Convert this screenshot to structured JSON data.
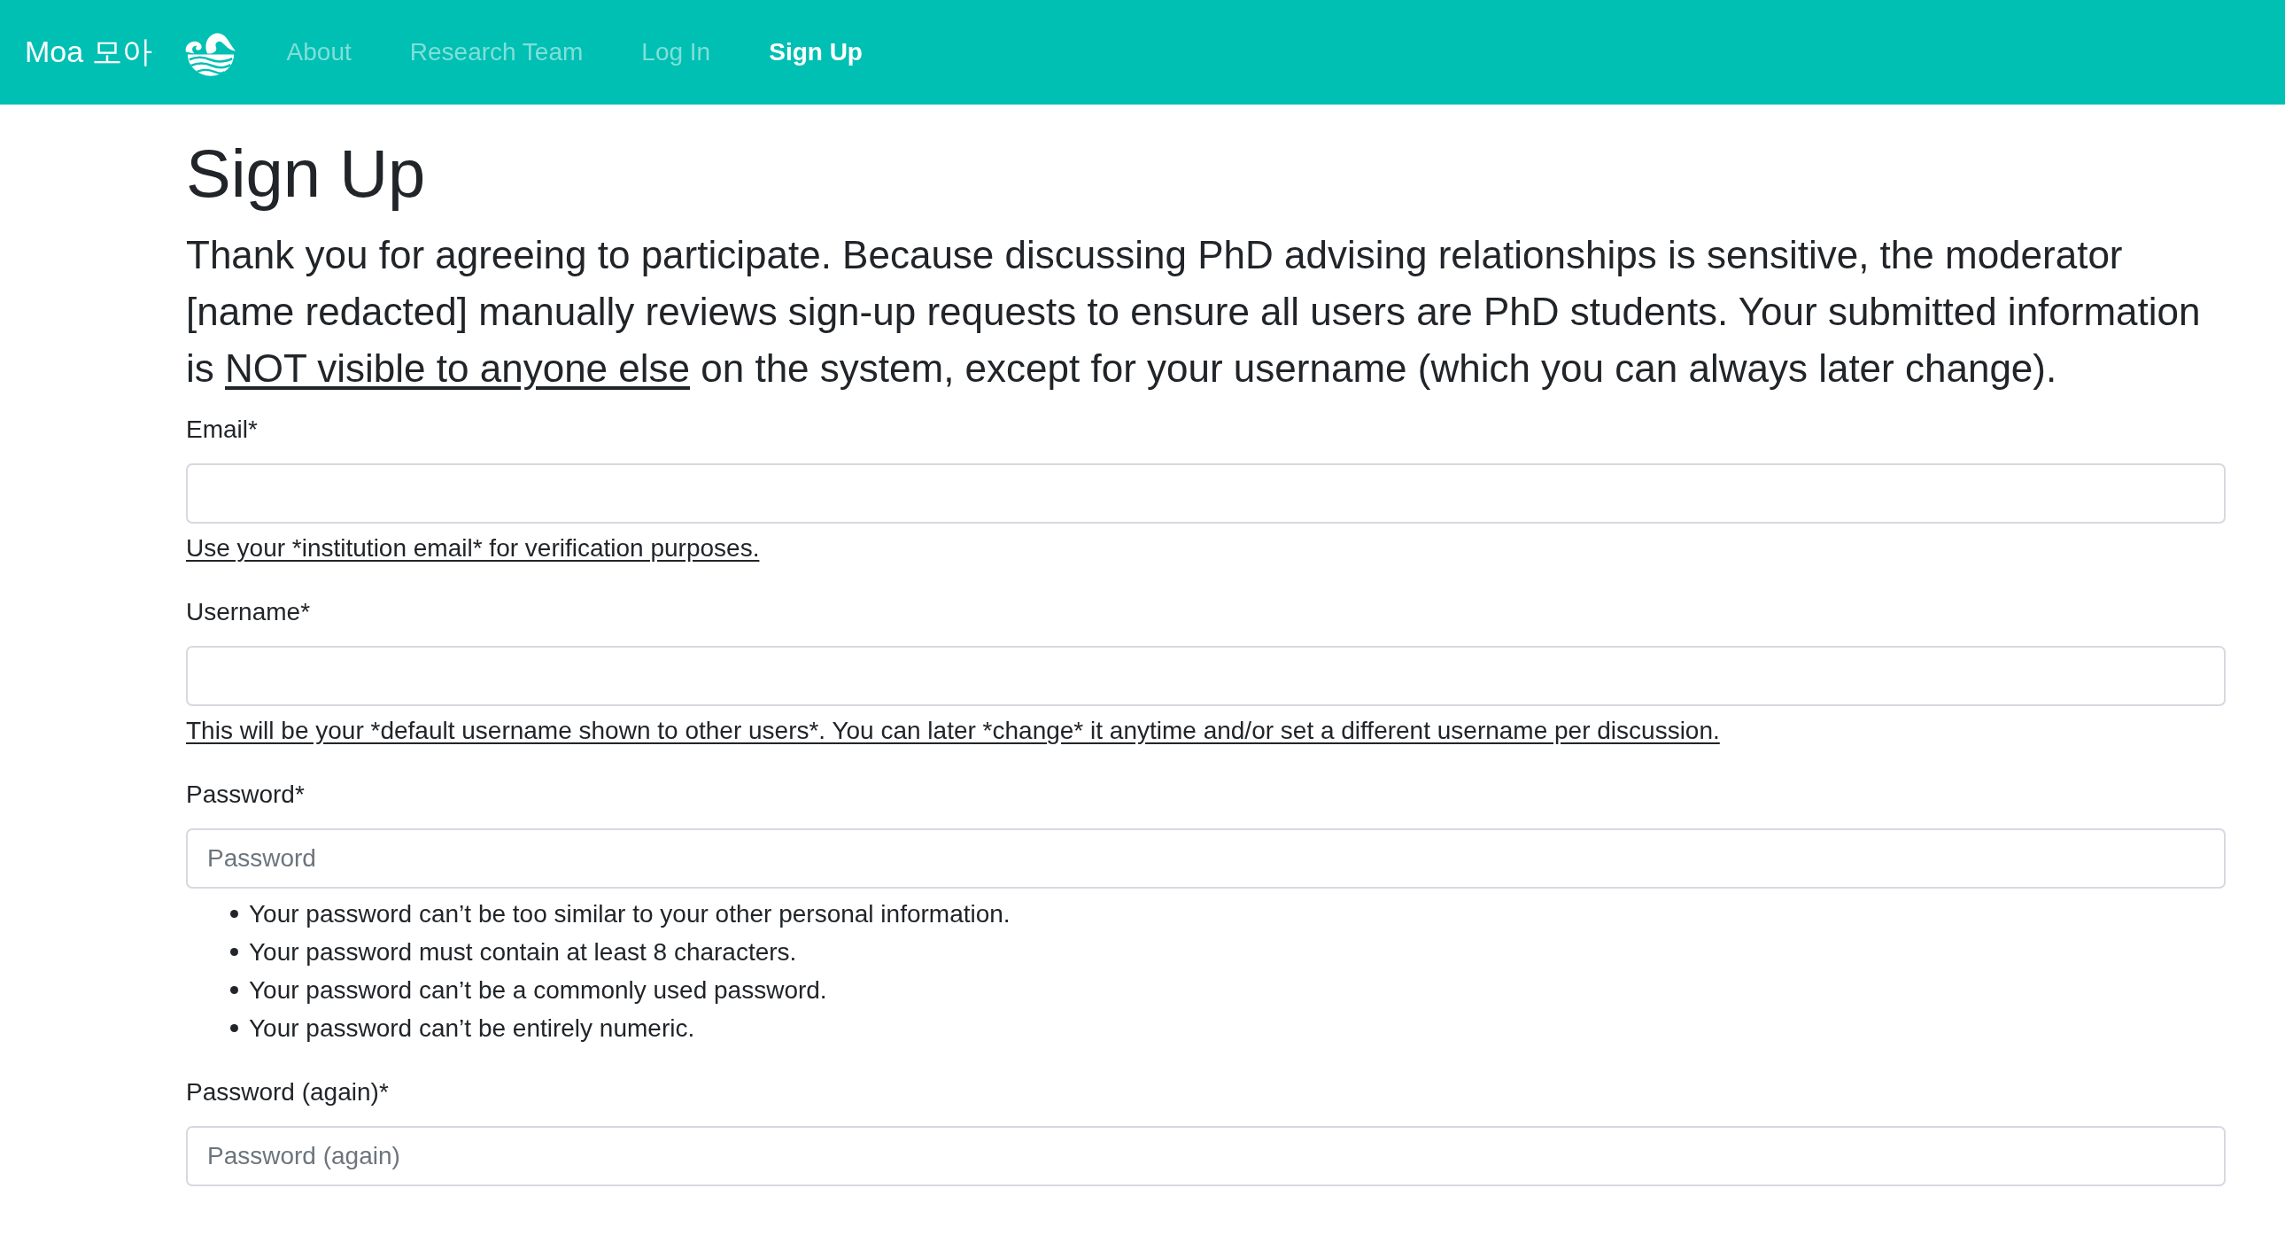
{
  "navbar": {
    "brand": "Moa 모아",
    "links": [
      {
        "label": "About",
        "selected": false
      },
      {
        "label": "Research Team",
        "selected": false
      },
      {
        "label": "Log In",
        "selected": false
      },
      {
        "label": "Sign Up",
        "selected": true
      }
    ]
  },
  "page": {
    "title": "Sign Up",
    "intro": [
      {
        "text": "Thank you for agreeing to participate. Because discussing PhD advising relationships is sensitive, the moderator [name redacted] manually reviews sign-up requests to ensure all users are PhD students. Your submitted information is ",
        "underlined": false
      },
      {
        "text": "NOT visible to anyone else",
        "underlined": true
      },
      {
        "text": " on the system, except for your username (which you can always later change).",
        "underlined": false
      }
    ]
  },
  "form": {
    "fields": [
      {
        "label": "Email*",
        "help": "Use your *institution email* for verification purposes."
      },
      {
        "label": "Username*",
        "help": "This will be your *default username shown to other users*. You can later *change* it anytime and/or set a different username per discussion."
      },
      {
        "label": "Password*",
        "placeholder": "Password",
        "rules": [
          "Your password can’t be too similar to your other personal information.",
          "Your password must contain at least 8 characters.",
          "Your password can’t be a commonly used password.",
          "Your password can’t be entirely numeric."
        ]
      },
      {
        "label": "Password (again)*",
        "placeholder": "Password (again)"
      }
    ]
  }
}
